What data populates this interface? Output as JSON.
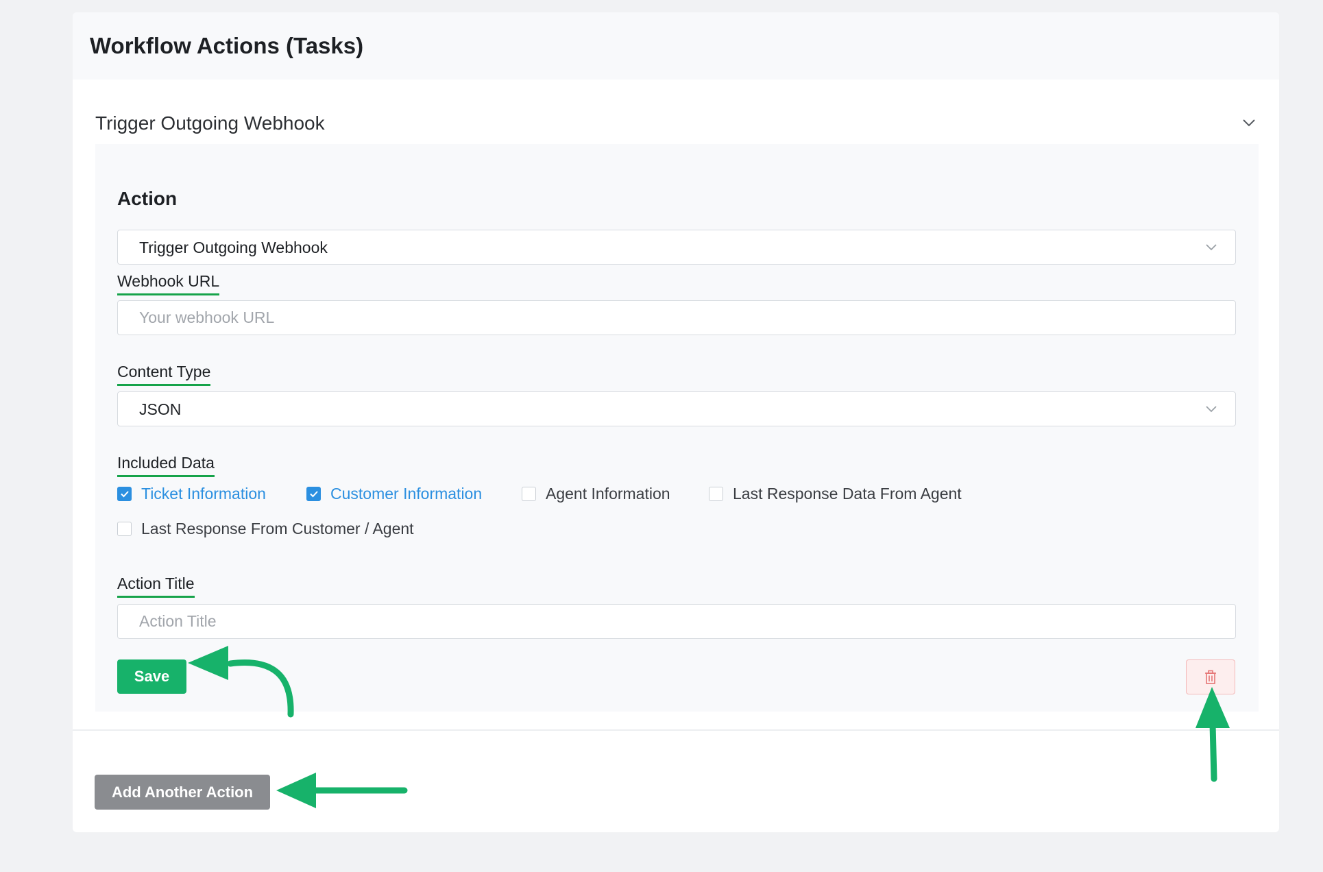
{
  "card": {
    "title": "Workflow Actions (Tasks)"
  },
  "accordion": {
    "title": "Trigger Outgoing Webhook",
    "chevron_icon": "chevron-down-icon"
  },
  "action": {
    "section_title": "Action",
    "selected": "Trigger Outgoing Webhook"
  },
  "webhook_url": {
    "label": "Webhook URL",
    "placeholder": "Your webhook URL",
    "value": ""
  },
  "content_type": {
    "label": "Content Type",
    "selected": "JSON"
  },
  "included_data": {
    "label": "Included Data",
    "options": [
      {
        "label": "Ticket Information",
        "checked": true
      },
      {
        "label": "Customer Information",
        "checked": true
      },
      {
        "label": "Agent Information",
        "checked": false
      },
      {
        "label": "Last Response Data From Agent",
        "checked": false
      },
      {
        "label": "Last Response From Customer / Agent",
        "checked": false
      }
    ]
  },
  "action_title": {
    "label": "Action Title",
    "placeholder": "Action Title",
    "value": ""
  },
  "buttons": {
    "save": "Save",
    "delete_icon": "trash-icon",
    "add_another": "Add Another Action"
  },
  "colors": {
    "accent_green": "#17b26a",
    "check_blue": "#2b8fe0",
    "annotation_arrow": "#17b26a",
    "delete_red": "#e57373"
  }
}
